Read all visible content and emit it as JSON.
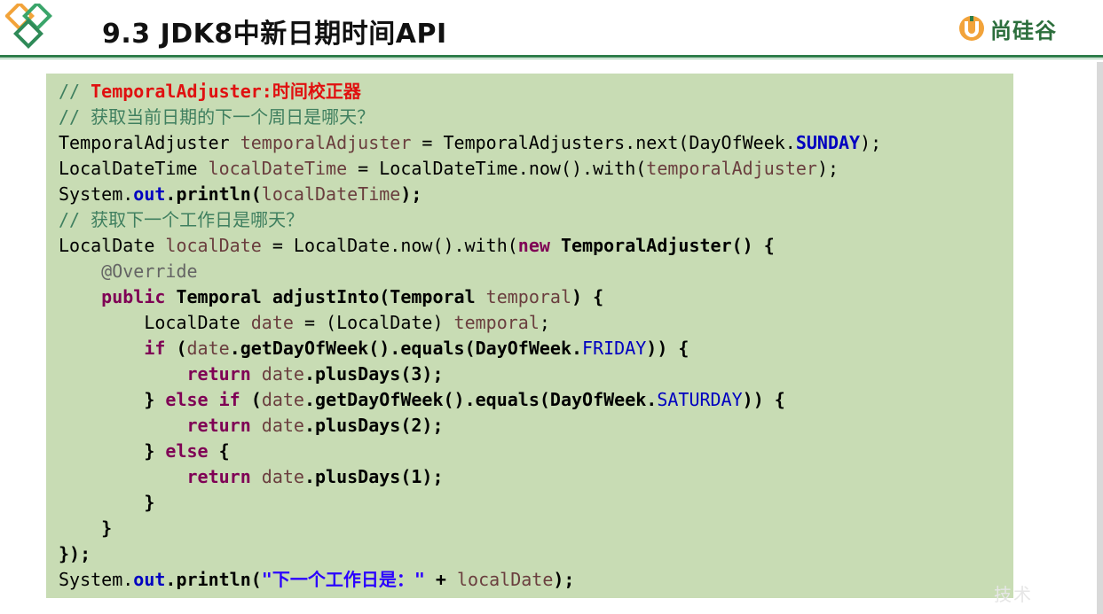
{
  "slide": {
    "title": "9.3 JDK8中新日期时间API",
    "brand": "尚硅谷",
    "watermark": "技术"
  },
  "colors": {
    "accent": "#2e7d4a",
    "code_bg": "#c8dcb4",
    "comment": "#3f7f5f",
    "keyword": "#7f0055",
    "static_field": "#0000c0",
    "highlight_comment": "#e01010"
  },
  "code": {
    "lines": [
      [
        {
          "t": "// ",
          "c": "c"
        },
        {
          "t": "TemporalAdjuster:时间校正器",
          "c": "cr"
        }
      ],
      [
        {
          "t": "// 获取当前日期的下一个周日是哪天？",
          "c": "c"
        }
      ],
      [
        {
          "t": "TemporalAdjuster ",
          "c": "t"
        },
        {
          "t": "temporalAdjuster",
          "c": "v"
        },
        {
          "t": " = TemporalAdjusters.next(DayOfWeek.",
          "c": "t"
        },
        {
          "t": "SUNDAY",
          "c": "stb"
        },
        {
          "t": ");",
          "c": "t"
        }
      ],
      [
        {
          "t": "LocalDateTime ",
          "c": "t"
        },
        {
          "t": "localDateTime",
          "c": "v"
        },
        {
          "t": " = LocalDateTime.now().with(",
          "c": "t"
        },
        {
          "t": "temporalAdjuster",
          "c": "v"
        },
        {
          "t": ");",
          "c": "t"
        }
      ],
      [
        {
          "t": "System.",
          "c": "t"
        },
        {
          "t": "out",
          "c": "stb"
        },
        {
          "t": ".println(",
          "c": "b"
        },
        {
          "t": "localDateTime",
          "c": "v"
        },
        {
          "t": ");",
          "c": "b"
        }
      ],
      [
        {
          "t": "// 获取下一个工作日是哪天？",
          "c": "c"
        }
      ],
      [
        {
          "t": "LocalDate ",
          "c": "t"
        },
        {
          "t": "localDate",
          "c": "v"
        },
        {
          "t": " = LocalDate.now().with(",
          "c": "t"
        },
        {
          "t": "new",
          "c": "kw"
        },
        {
          "t": " TemporalAdjuster() {",
          "c": "b"
        }
      ],
      [
        {
          "t": "    ",
          "c": "t"
        },
        {
          "t": "@Override",
          "c": "ann"
        }
      ],
      [
        {
          "t": "    ",
          "c": "t"
        },
        {
          "t": "public",
          "c": "kw"
        },
        {
          "t": " Temporal adjustInto(Temporal ",
          "c": "b"
        },
        {
          "t": "temporal",
          "c": "v"
        },
        {
          "t": ") {",
          "c": "b"
        }
      ],
      [
        {
          "t": "        LocalDate ",
          "c": "t"
        },
        {
          "t": "date",
          "c": "v"
        },
        {
          "t": " = (LocalDate) ",
          "c": "t"
        },
        {
          "t": "temporal",
          "c": "v"
        },
        {
          "t": ";",
          "c": "t"
        }
      ],
      [
        {
          "t": "        ",
          "c": "t"
        },
        {
          "t": "if",
          "c": "kw"
        },
        {
          "t": " (",
          "c": "b"
        },
        {
          "t": "date",
          "c": "v"
        },
        {
          "t": ".getDayOfWeek().equals(DayOfWeek.",
          "c": "b"
        },
        {
          "t": "FRIDAY",
          "c": "st"
        },
        {
          "t": ")) {",
          "c": "b"
        }
      ],
      [
        {
          "t": "            ",
          "c": "t"
        },
        {
          "t": "return",
          "c": "kw"
        },
        {
          "t": " ",
          "c": "t"
        },
        {
          "t": "date",
          "c": "v"
        },
        {
          "t": ".plusDays(3);",
          "c": "b"
        }
      ],
      [
        {
          "t": "        } ",
          "c": "b"
        },
        {
          "t": "else if",
          "c": "kw"
        },
        {
          "t": " (",
          "c": "b"
        },
        {
          "t": "date",
          "c": "v"
        },
        {
          "t": ".getDayOfWeek().equals(DayOfWeek.",
          "c": "b"
        },
        {
          "t": "SATURDAY",
          "c": "st"
        },
        {
          "t": ")) {",
          "c": "b"
        }
      ],
      [
        {
          "t": "            ",
          "c": "t"
        },
        {
          "t": "return",
          "c": "kw"
        },
        {
          "t": " ",
          "c": "t"
        },
        {
          "t": "date",
          "c": "v"
        },
        {
          "t": ".plusDays(2);",
          "c": "b"
        }
      ],
      [
        {
          "t": "        } ",
          "c": "b"
        },
        {
          "t": "else",
          "c": "kw"
        },
        {
          "t": " {",
          "c": "b"
        }
      ],
      [
        {
          "t": "            ",
          "c": "t"
        },
        {
          "t": "return",
          "c": "kw"
        },
        {
          "t": " ",
          "c": "t"
        },
        {
          "t": "date",
          "c": "v"
        },
        {
          "t": ".plusDays(1);",
          "c": "b"
        }
      ],
      [
        {
          "t": "        }",
          "c": "b"
        }
      ],
      [
        {
          "t": "    }",
          "c": "b"
        }
      ],
      [
        {
          "t": "});",
          "c": "b"
        }
      ],
      [
        {
          "t": "System.",
          "c": "t"
        },
        {
          "t": "out",
          "c": "stb"
        },
        {
          "t": ".println(",
          "c": "b"
        },
        {
          "t": "\"下一个工作日是：\"",
          "c": "str"
        },
        {
          "t": " + ",
          "c": "b"
        },
        {
          "t": "localDate",
          "c": "v"
        },
        {
          "t": ");",
          "c": "b"
        }
      ]
    ]
  }
}
